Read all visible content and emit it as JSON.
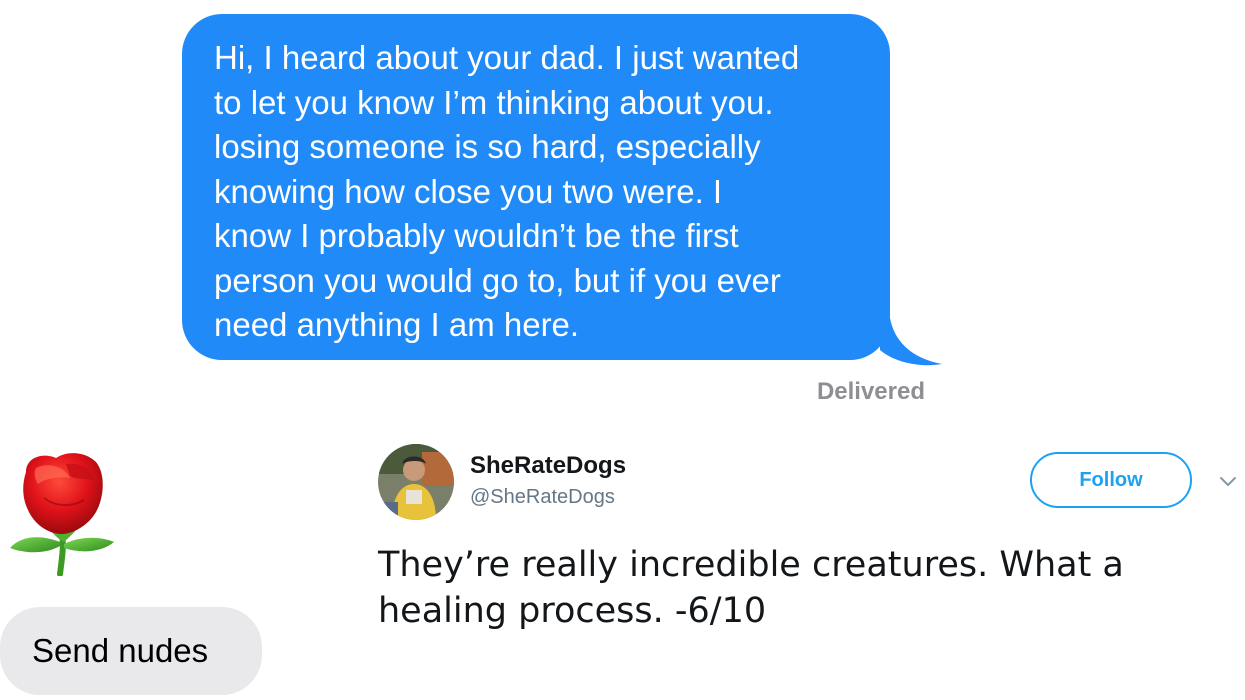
{
  "sent_message": {
    "text": "Hi, I heard about your dad. I just wanted\nto let you know I’m thinking about you.\nlosing someone is so hard, especially\nknowing how close you two were. I\nknow I probably wouldn’t be the first\nperson you would go to, but if you ever\nneed anything I am here.",
    "status": "Delivered",
    "bubble_color": "#1f8af8"
  },
  "received_messages": [
    {
      "type": "emoji",
      "icon": "rose-emoji"
    },
    {
      "type": "text",
      "text": "Send nudes",
      "bubble_color": "#e9e9eb"
    }
  ],
  "tweet": {
    "author_name": "SheRateDogs",
    "author_handle": "@SheRateDogs",
    "follow_label": "Follow",
    "text": "They’re really incredible creatures. What a\nhealing process. -6/10",
    "accent_color": "#1da1f2",
    "icons": [
      "avatar",
      "chevron-down-icon"
    ]
  }
}
